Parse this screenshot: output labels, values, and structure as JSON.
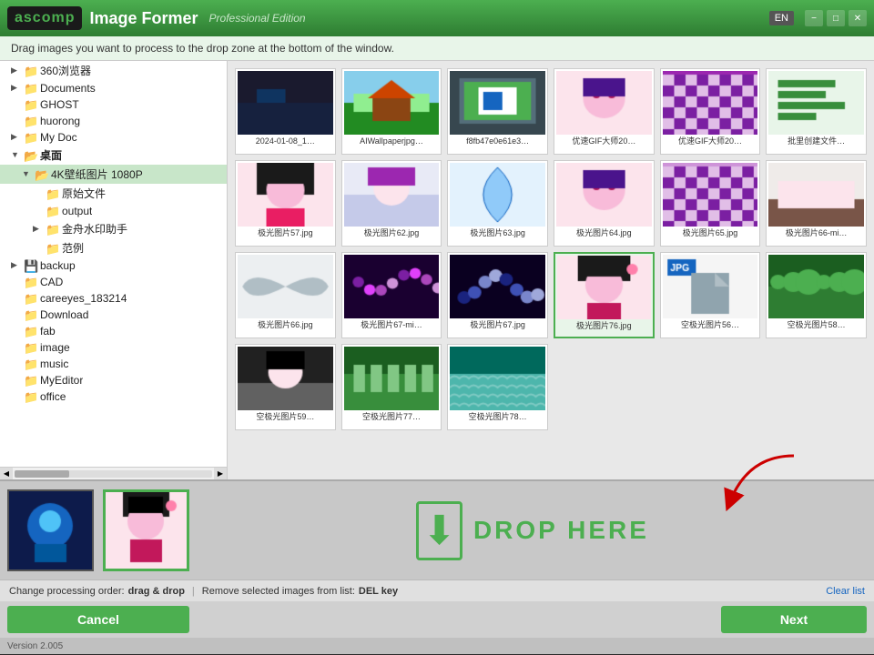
{
  "titlebar": {
    "logo": "ascomp",
    "app_name": "Image Former",
    "edition": "Professional Edition",
    "lang_btn": "EN",
    "min_btn": "−",
    "max_btn": "□",
    "close_btn": "✕"
  },
  "instruction": {
    "text": "Drag images you want to process to the drop zone at the bottom of the window."
  },
  "tree": {
    "items": [
      {
        "id": "360browser",
        "label": "360浏览器",
        "indent": 1,
        "type": "folder",
        "expanded": false,
        "arrow": "▶"
      },
      {
        "id": "documents",
        "label": "Documents",
        "indent": 1,
        "type": "folder",
        "expanded": false,
        "arrow": "▶"
      },
      {
        "id": "ghost",
        "label": "GHOST",
        "indent": 1,
        "type": "folder",
        "expanded": false,
        "arrow": ""
      },
      {
        "id": "huorong",
        "label": "huorong",
        "indent": 1,
        "type": "folder",
        "expanded": false,
        "arrow": ""
      },
      {
        "id": "mydoc",
        "label": "My Doc",
        "indent": 1,
        "type": "folder",
        "expanded": false,
        "arrow": "▶"
      },
      {
        "id": "desktop",
        "label": "桌面",
        "indent": 1,
        "type": "folder",
        "expanded": true,
        "arrow": "▼"
      },
      {
        "id": "wallpaper1080p",
        "label": "4K壁纸图片 1080P",
        "indent": 2,
        "type": "folder",
        "expanded": true,
        "arrow": "▼"
      },
      {
        "id": "original",
        "label": "原始文件",
        "indent": 3,
        "type": "folder",
        "expanded": false,
        "arrow": ""
      },
      {
        "id": "output",
        "label": "output",
        "indent": 3,
        "type": "folder",
        "expanded": false,
        "arrow": ""
      },
      {
        "id": "jinshu",
        "label": "金舟水印助手",
        "indent": 3,
        "type": "folder",
        "expanded": false,
        "arrow": "▶"
      },
      {
        "id": "examples",
        "label": "范例",
        "indent": 3,
        "type": "folder",
        "expanded": false,
        "arrow": ""
      },
      {
        "id": "backup",
        "label": "backup",
        "indent": 1,
        "type": "drive",
        "expanded": false,
        "arrow": "▶"
      },
      {
        "id": "cad",
        "label": "CAD",
        "indent": 1,
        "type": "folder",
        "expanded": false,
        "arrow": ""
      },
      {
        "id": "careeyes",
        "label": "careeyes_183214",
        "indent": 1,
        "type": "folder",
        "expanded": false,
        "arrow": ""
      },
      {
        "id": "download",
        "label": "Download",
        "indent": 1,
        "type": "folder",
        "expanded": false,
        "arrow": ""
      },
      {
        "id": "fab",
        "label": "fab",
        "indent": 1,
        "type": "folder",
        "expanded": false,
        "arrow": ""
      },
      {
        "id": "image",
        "label": "image",
        "indent": 1,
        "type": "folder",
        "expanded": false,
        "arrow": ""
      },
      {
        "id": "music",
        "label": "music",
        "indent": 1,
        "type": "folder",
        "expanded": false,
        "arrow": ""
      },
      {
        "id": "myeditor",
        "label": "MyEditor",
        "indent": 1,
        "type": "folder",
        "expanded": false,
        "arrow": ""
      },
      {
        "id": "office",
        "label": "office",
        "indent": 1,
        "type": "folder",
        "expanded": false,
        "arrow": ""
      }
    ]
  },
  "images": [
    {
      "id": "img1",
      "label": "2024-01-08_1…",
      "color": "#3a3a3a",
      "type": "dark_landscape",
      "selected": false
    },
    {
      "id": "img2",
      "label": "AIWallpaperjpg…",
      "color": "#8bc34a",
      "type": "garden",
      "selected": false
    },
    {
      "id": "img3",
      "label": "f8fb47e0e61e3…",
      "color": "#607d8b",
      "type": "monitor",
      "selected": false
    },
    {
      "id": "img4",
      "label": "优速GIF大师20…",
      "color": "#e91e63",
      "type": "flowers",
      "selected": false
    },
    {
      "id": "img5",
      "label": "优速GIF大师20…",
      "color": "#9c27b0",
      "type": "chess",
      "selected": false
    },
    {
      "id": "img6",
      "label": "批里创建文件…",
      "color": "#4caf50",
      "type": "text_icon",
      "selected": false
    },
    {
      "id": "img7",
      "label": "极光图片57.jpg",
      "color": "#e91e63",
      "type": "anime_girl1",
      "selected": false
    },
    {
      "id": "img8",
      "label": "极光图片62.jpg",
      "color": "#9c27b0",
      "type": "anime_girl2",
      "selected": false
    },
    {
      "id": "img9",
      "label": "极光图片63.jpg",
      "color": "#e3f2fd",
      "type": "feather",
      "selected": false
    },
    {
      "id": "img10",
      "label": "极光图片64.jpg",
      "color": "#f48fb1",
      "type": "anime_face",
      "selected": false
    },
    {
      "id": "img11",
      "label": "极光图片65.jpg",
      "color": "#ce93d8",
      "type": "pink_grid",
      "selected": false
    },
    {
      "id": "img12",
      "label": "极光图片66-mi…",
      "color": "#795548",
      "type": "reclining",
      "selected": false
    },
    {
      "id": "img13",
      "label": "极光图片66.jpg",
      "color": "#b0bec5",
      "type": "wings",
      "selected": false
    },
    {
      "id": "img14",
      "label": "极光图片67-mi…",
      "color": "#7b1fa2",
      "type": "magic_dark",
      "selected": false
    },
    {
      "id": "img15",
      "label": "极光图片67.jpg",
      "color": "#1a237e",
      "type": "magic_blue",
      "selected": false
    },
    {
      "id": "img16",
      "label": "极光图片76.jpg",
      "color": "#f8bbd9",
      "type": "anime_selected",
      "selected": true
    },
    {
      "id": "img17",
      "label": "空极光图片56…",
      "color": "#f5f5f5",
      "type": "jpg_badge",
      "selected": false
    },
    {
      "id": "img18",
      "label": "空极光图片58…",
      "color": "#558b2f",
      "type": "nature_green",
      "selected": false
    },
    {
      "id": "img19",
      "label": "空极光图片59…",
      "color": "#37474f",
      "type": "dark_anime",
      "selected": false
    },
    {
      "id": "img20",
      "label": "空极光图片77…",
      "color": "#1b5e20",
      "type": "forest_green",
      "selected": false
    },
    {
      "id": "img21",
      "label": "空极光图片78…",
      "color": "#4db6ac",
      "type": "ocean_green",
      "selected": false
    }
  ],
  "drop_zone": {
    "text": "DROP HERE",
    "icon": "⬇"
  },
  "status_bar": {
    "change_text": "Change processing order:",
    "drag_drop": "drag & drop",
    "separator": "|",
    "remove_text": "Remove selected images from list:",
    "del_key": "DEL key",
    "clear_list": "Clear list"
  },
  "buttons": {
    "cancel": "Cancel",
    "next": "Next"
  },
  "version": {
    "text": "Version 2.005"
  },
  "previews": [
    {
      "id": "prev1",
      "color": "#1565c0",
      "type": "sci_fi"
    },
    {
      "id": "prev2",
      "color": "#f8bbd9",
      "type": "anime_girl",
      "active": true
    }
  ]
}
